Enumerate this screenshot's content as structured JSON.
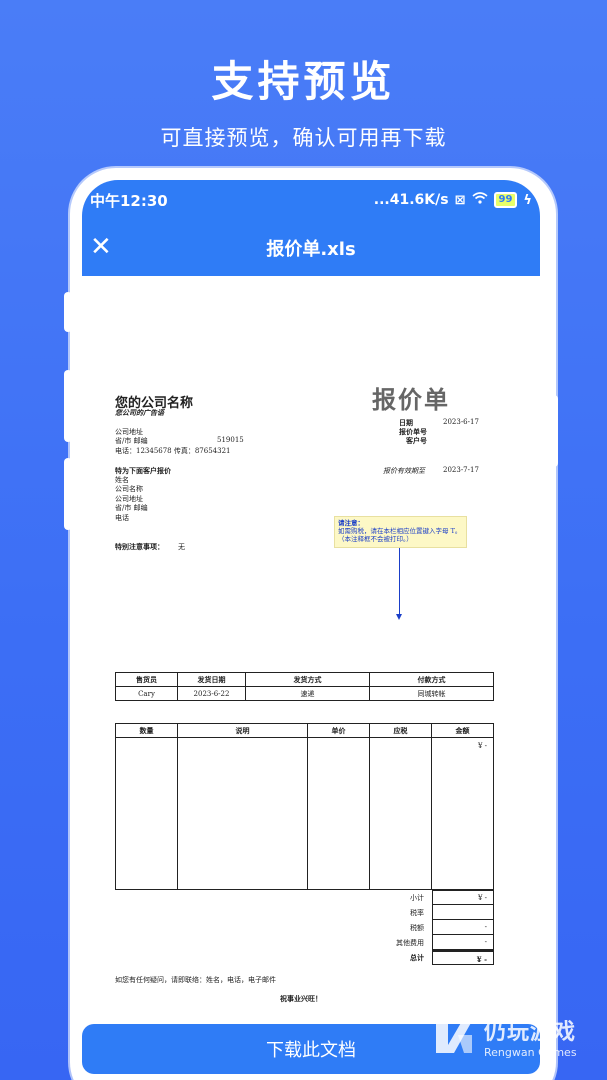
{
  "promo": {
    "title": "支持预览",
    "subtitle": "可直接预览，确认可用再下载"
  },
  "status_bar": {
    "time": "中午12:30",
    "network_speed": "...41.6K/s",
    "battery": "99"
  },
  "titlebar": {
    "title": "报价单.xls",
    "close_icon": "close-icon"
  },
  "document": {
    "company_name": "您的公司名称",
    "company_slogan": "您公司的广告语",
    "quote_title": "报价单",
    "company_address": "公司地址",
    "province_city_zip": "省/市  邮编",
    "zip_value": "519015",
    "phone_fax": "电话：12345678  传真：87654321",
    "date_label": "日期",
    "date_value": "2023-6-17",
    "quote_no_label": "报价单号",
    "customer_no_label": "客户号",
    "quote_for_label": "特为下面客户报价",
    "valid_until_label": "报价有效期至",
    "valid_until_value": "2023-7-17",
    "cust_name": "姓名",
    "cust_company": "公司名称",
    "cust_address": "公司地址",
    "cust_city": "省/市  邮编",
    "cust_phone": "电话",
    "notice_title": "请注意：",
    "notice_body": "如需购税，请在本栏相应位置键入字母 T。      （本注释框不会被打印。）",
    "special_notes_label": "特别注意事项：",
    "special_notes_value": "无",
    "shipping_headers": [
      "售货员",
      "发货日期",
      "发货方式",
      "付款方式"
    ],
    "shipping_values": [
      "Cary",
      "2023-6-22",
      "速递",
      "同城转帐"
    ],
    "item_headers": [
      "数量",
      "说明",
      "单价",
      "应税",
      "金额"
    ],
    "first_amount": "¥ -",
    "totals": [
      {
        "label": "小计",
        "value": "¥ -"
      },
      {
        "label": "税率",
        "value": ""
      },
      {
        "label": "税额",
        "value": "-"
      },
      {
        "label": "其他费用",
        "value": "-"
      },
      {
        "label": "总计",
        "value": "¥ -"
      }
    ],
    "contact_line": "如您有任何疑问，请即联络：姓名，电话，电子邮件",
    "closing": "祝事业兴旺！"
  },
  "download_button": "下载此文档",
  "watermark": {
    "name": "仍玩游戏",
    "sub": "Rengwan Games"
  }
}
